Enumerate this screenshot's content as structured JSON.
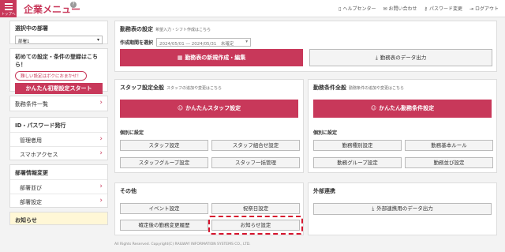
{
  "header": {
    "menu_label": "トップへ",
    "title": "企業メニュー",
    "help": "?",
    "links": [
      {
        "icon": "book-icon",
        "label": "ヘルプセンター"
      },
      {
        "icon": "mail-icon",
        "label": "お問い合わせ"
      },
      {
        "icon": "key-icon",
        "label": "パスワード変更"
      },
      {
        "icon": "logout-icon",
        "label": "ログアウト"
      }
    ]
  },
  "sidebar": {
    "dept_title": "選択中の部署",
    "dept_value": "部署1",
    "first_title": "初めての設定・条件の登録はこちら！",
    "first_pill": "難しい設定はボクにおまかせ！",
    "first_button": "かんたん初期設定スタート",
    "work_conditions": "勤務条件一覧",
    "id_title": "ID・パスワード発行",
    "id_items": [
      "管理者用",
      "スマホアクセス"
    ],
    "dept_info_title": "部署情報変更",
    "dept_items": [
      "部署並び",
      "部署設定"
    ],
    "notice": "お知らせ"
  },
  "shift_panel": {
    "title": "勤務表の設定",
    "subtitle": "希望入力・シフト作成はこちら",
    "period_label": "作成期間を選択",
    "period_value": "2024/05/01 ― 2024/05/31　未確定",
    "new_button": "勤務表の新規作成・編集",
    "export_button": "勤務表のデータ出力"
  },
  "staff_panel": {
    "title": "スタッフ設定全般",
    "subtitle": "スタッフの追加や変更はこちら",
    "easy_button": "かんたんスタッフ設定",
    "sub_title": "個別に設定",
    "buttons": [
      "スタッフ設定",
      "スタッフ組合せ設定",
      "スタッフグループ設定",
      "スタッフ一括管理"
    ]
  },
  "cond_panel": {
    "title": "勤務条件全般",
    "subtitle": "勤務条件の追加や変更はこちら",
    "easy_button": "かんたん勤務条件設定",
    "sub_title": "個別に設定",
    "buttons": [
      "勤務種別設定",
      "勤務基本ルール",
      "勤務グループ設定",
      "勤務並び設定"
    ]
  },
  "other_panel": {
    "title": "その他",
    "buttons": [
      "イベント設定",
      "祝祭日設定",
      "確定後の勤務変更履歴",
      "お知らせ設定"
    ]
  },
  "ext_panel": {
    "title": "外部連携",
    "button": "外部連携用のデータ出力"
  },
  "footer": "All Rights Reserved. Copyright(C) RAILWAY INFORMATION SYSTEMS CO., LTD.",
  "colors": {
    "accent": "#c8385a",
    "highlight": "#d6152e"
  }
}
